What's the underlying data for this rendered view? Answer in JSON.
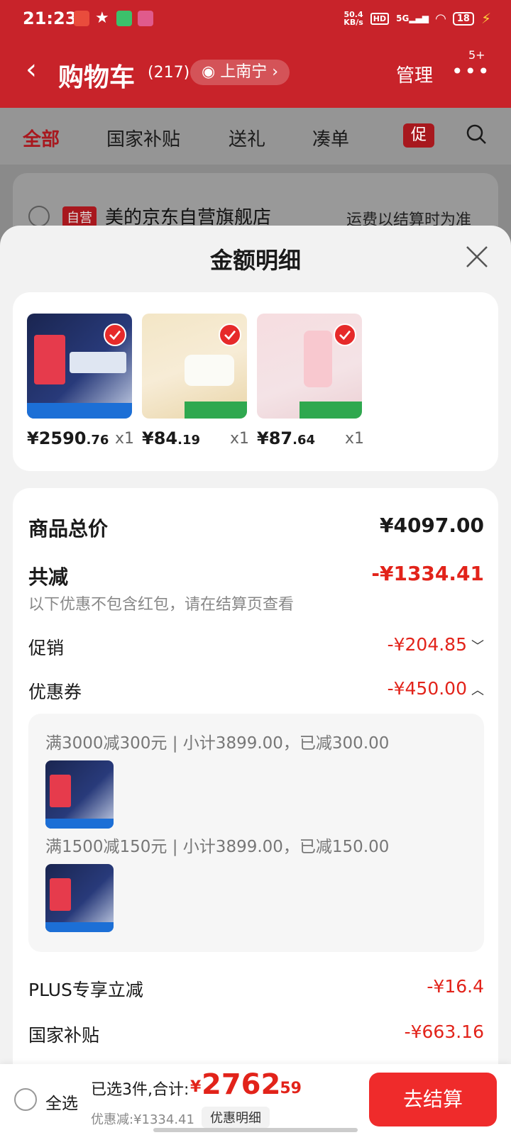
{
  "status_bar": {
    "time": "21:23",
    "net_speed": "50.4",
    "net_unit": "KB/s",
    "hd": "HD",
    "signal": "5G",
    "battery": "18"
  },
  "header": {
    "title": "购物车",
    "count": "(217)",
    "location": "上南宁",
    "manage": "管理",
    "more_badge": "5+"
  },
  "tabs": [
    {
      "label": "全部"
    },
    {
      "label": "国家补贴"
    },
    {
      "label": "送礼"
    },
    {
      "label": "凑单"
    }
  ],
  "promo_tab": "促",
  "store": {
    "tag": "自营",
    "name": "美的京东自营旗舰店",
    "shipping": "运费以结算时为准"
  },
  "sheet": {
    "title": "金额明细",
    "products": [
      {
        "price_int": "¥2590",
        "price_dec": ".76",
        "qty": "x1"
      },
      {
        "price_int": "¥84",
        "price_dec": ".19",
        "qty": "x1"
      },
      {
        "price_int": "¥87",
        "price_dec": ".64",
        "qty": "x1"
      }
    ],
    "details": {
      "total_label": "商品总价",
      "total_value": "¥4097.00",
      "reduce_label": "共减",
      "reduce_value": "-¥1334.41",
      "reduce_note": "以下优惠不包含红包，请在结算页查看",
      "promo_label": "促销",
      "promo_value": "-¥204.85",
      "coupon_label": "优惠券",
      "coupon_value": "-¥450.00",
      "coupons": [
        {
          "text": "满3000减300元 | 小计3899.00，已减300.00"
        },
        {
          "text": "满1500减150元 | 小计3899.00，已减150.00"
        }
      ],
      "plus_label": "PLUS专享立减",
      "plus_value": "-¥16.4",
      "subsidy_label": "国家补贴",
      "subsidy_value": "-¥663.16"
    }
  },
  "bottom": {
    "select_all": "全选",
    "selected": "已选3件,合计:",
    "yen": "¥",
    "total_int": "2762",
    "total_dec": ".59",
    "discount": "优惠减:¥1334.41",
    "detail_button": "优惠明细",
    "checkout": "去结算"
  },
  "colors": {
    "brand_red": "#e2231a",
    "header_red": "#c8232a",
    "checkout_red": "#ef2b2b"
  }
}
